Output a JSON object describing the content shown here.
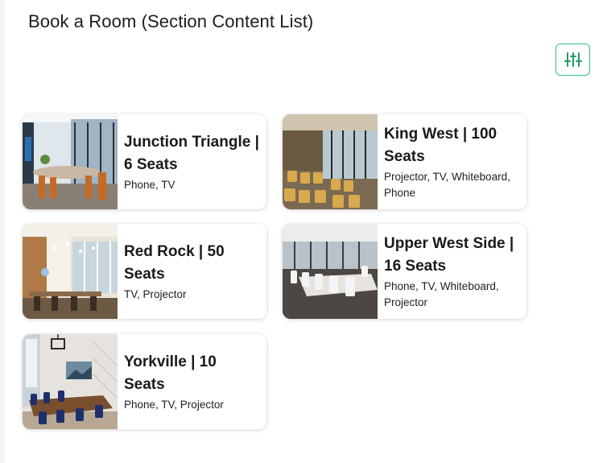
{
  "header": {
    "title": "Book a Room (Section Content List)"
  },
  "toolbar": {
    "filter_icon": "sliders-icon",
    "accent_color": "#2fc27a"
  },
  "rooms": [
    {
      "title": "Junction Triangle | 6 Seats",
      "amenities": "Phone, TV"
    },
    {
      "title": "King West | 100 Seats",
      "amenities": "Projector, TV, Whiteboard, Phone"
    },
    {
      "title": "Red Rock | 50 Seats",
      "amenities": "TV, Projector"
    },
    {
      "title": "Upper West Side | 16 Seats",
      "amenities": "Phone, TV, Whiteboard, Projector"
    },
    {
      "title": "Yorkville | 10 Seats",
      "amenities": "Phone, TV, Projector"
    }
  ]
}
